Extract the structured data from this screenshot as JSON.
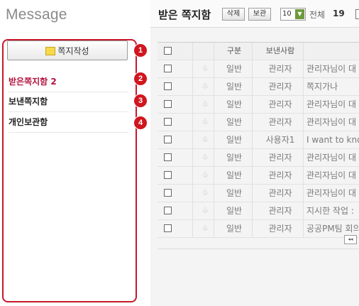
{
  "sidebar": {
    "title": "Message",
    "compose_label": "쪽지작성",
    "items": [
      {
        "label": "받은쪽지함 2",
        "active": true
      },
      {
        "label": "보낸쪽지함",
        "active": false
      },
      {
        "label": "개인보관함",
        "active": false
      }
    ],
    "badges": [
      "1",
      "2",
      "3",
      "4"
    ],
    "accent_color": "#c8182a"
  },
  "main": {
    "title": "받은 쪽지함",
    "delete_label": "삭제",
    "keep_label": "보관",
    "page_size": "10",
    "total_label": "전체",
    "total_count": "19",
    "columns": [
      "구분",
      "보낸사람"
    ],
    "rows": [
      {
        "type": "일반",
        "sender": "관리자",
        "subject": "관리자님이 대"
      },
      {
        "type": "일반",
        "sender": "관리자",
        "subject": "쪽지가나"
      },
      {
        "type": "일반",
        "sender": "관리자",
        "subject": "관리자님이 대"
      },
      {
        "type": "일반",
        "sender": "관리자",
        "subject": "관리자님이 대"
      },
      {
        "type": "일반",
        "sender": "사용자1",
        "subject": "I want to kno"
      },
      {
        "type": "일반",
        "sender": "관리자",
        "subject": "관리자님이 대"
      },
      {
        "type": "일반",
        "sender": "관리자",
        "subject": "관리자님이 대"
      },
      {
        "type": "일반",
        "sender": "관리자",
        "subject": "관리자님이 대"
      },
      {
        "type": "일반",
        "sender": "관리자",
        "subject": "지시한 작업 :"
      },
      {
        "type": "일반",
        "sender": "관리자",
        "subject": "공공PM팀 회의"
      }
    ],
    "pager_prev": "◂◂"
  }
}
